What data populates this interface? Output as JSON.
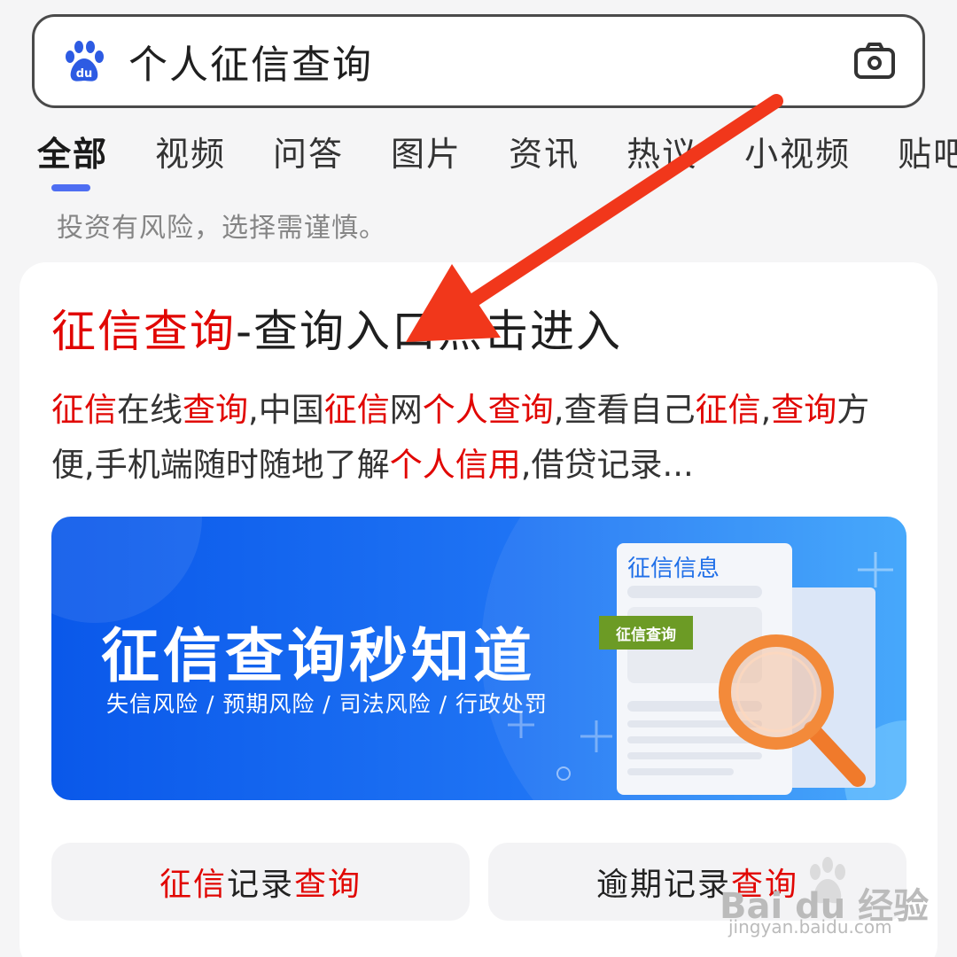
{
  "search": {
    "query": "个人征信查询",
    "logo_icon": "baidu-paw-icon",
    "logo_text": "du",
    "camera_icon": "camera-icon"
  },
  "tabs": [
    {
      "label": "全部",
      "active": true
    },
    {
      "label": "视频",
      "active": false
    },
    {
      "label": "问答",
      "active": false
    },
    {
      "label": "图片",
      "active": false
    },
    {
      "label": "资讯",
      "active": false
    },
    {
      "label": "热议",
      "active": false
    },
    {
      "label": "小视频",
      "active": false
    },
    {
      "label": "贴吧",
      "active": false
    }
  ],
  "risk_note": "投资有风险，选择需谨慎。",
  "result": {
    "title_hl": "征信查询",
    "title_rest": "-查询入口点击进入",
    "desc": [
      {
        "t": "征信",
        "hl": true
      },
      {
        "t": "在线",
        "hl": false
      },
      {
        "t": "查询",
        "hl": true
      },
      {
        "t": ",中国",
        "hl": false
      },
      {
        "t": "征信",
        "hl": true
      },
      {
        "t": "网",
        "hl": false
      },
      {
        "t": "个人查询",
        "hl": true
      },
      {
        "t": ",查看自己",
        "hl": false
      },
      {
        "t": "征信",
        "hl": true
      },
      {
        "t": ",",
        "hl": false
      },
      {
        "t": "查询",
        "hl": true
      },
      {
        "t": "方便,手机端随时随地了解",
        "hl": false
      },
      {
        "t": "个人信用",
        "hl": true
      },
      {
        "t": ",借贷记录...",
        "hl": false
      }
    ],
    "banner": {
      "title": "征信查询秒知道",
      "subtitle": "失信风险 / 预期风险 / 司法风险 / 行政处罚",
      "doc_title": "征信信息",
      "doc_tag": "征信查询"
    },
    "buttons": [
      {
        "parts": [
          {
            "t": "征信",
            "hl": true
          },
          {
            "t": "记录",
            "hl": false
          },
          {
            "t": "查询",
            "hl": true
          }
        ]
      },
      {
        "parts": [
          {
            "t": "逾期记录",
            "hl": false
          },
          {
            "t": "查询",
            "hl": true
          }
        ]
      }
    ]
  },
  "watermark": {
    "brand": "Bai du 经验",
    "url": "jingyan.baidu.com"
  },
  "colors": {
    "highlight": "#e10602",
    "accent": "#4e6ef2",
    "arrow": "#f1371b",
    "banner": "#1f74f4"
  }
}
